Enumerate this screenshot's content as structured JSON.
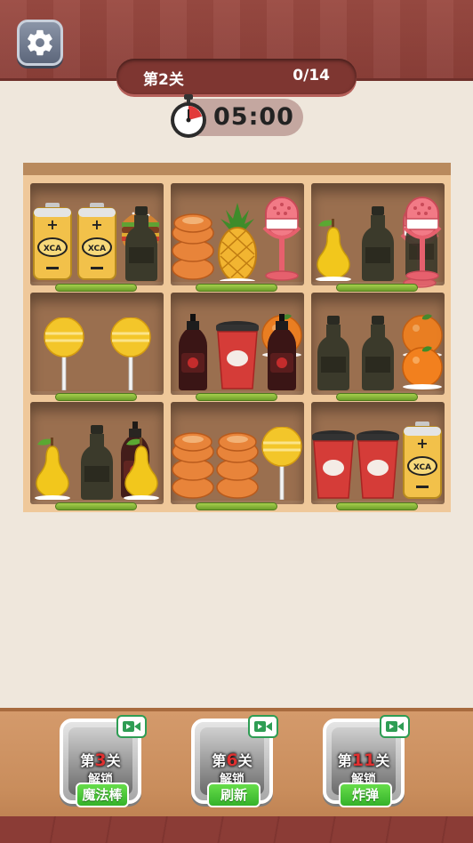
{
  "header": {
    "level_label": "第2关",
    "progress": "0/14",
    "timer": "05:00"
  },
  "icons": {
    "settings": "gear-icon",
    "timer": "stopwatch-icon",
    "video": "video-ad-icon"
  },
  "shelves": [
    {
      "items": [
        "battery",
        "battery",
        "dark-bottle",
        "burger"
      ]
    },
    {
      "items": [
        "donut-stack",
        "pineapple",
        "microphone"
      ]
    },
    {
      "items": [
        "pear",
        "dark-bottle",
        "microphone",
        "microphone",
        "dark-bottle"
      ]
    },
    {
      "items": [
        "lollipop",
        "lollipop"
      ]
    },
    {
      "items": [
        "sauce-bottle",
        "coffee-cup",
        "sauce-bottle",
        "orange"
      ]
    },
    {
      "items": [
        "dark-bottle",
        "dark-bottle",
        "orange",
        "orange"
      ]
    },
    {
      "items": [
        "pear",
        "dark-bottle",
        "pear",
        "sauce-bottle"
      ]
    },
    {
      "items": [
        "donut-stack",
        "donut-stack",
        "lollipop"
      ]
    },
    {
      "items": [
        "coffee-cup",
        "coffee-cup",
        "battery"
      ]
    }
  ],
  "battery_label": "XCA",
  "tools": [
    {
      "prefix": "第",
      "num": "3",
      "suffix": "关",
      "unlock": "解锁",
      "name": "魔法棒",
      "icon": "magic-wand-icon"
    },
    {
      "prefix": "第",
      "num": "6",
      "suffix": "关",
      "unlock": "解锁",
      "name": "刷新",
      "icon": "refresh-icon"
    },
    {
      "prefix": "第",
      "num": "11",
      "suffix": "关",
      "unlock": "解锁",
      "name": "炸弹",
      "icon": "bomb-icon"
    }
  ],
  "colors": {
    "bar_green": "#8bc43c",
    "tag_green": "#46c43a",
    "banner": "#8b3f38"
  }
}
